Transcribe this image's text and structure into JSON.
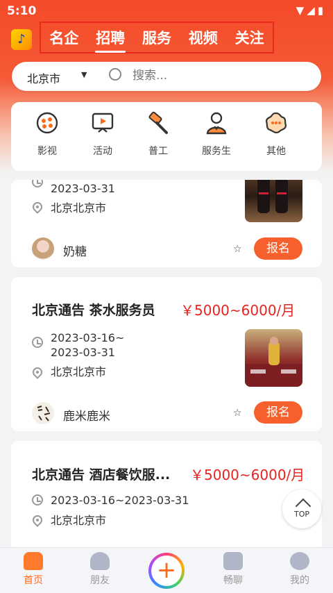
{
  "status": {
    "time": "5:10"
  },
  "top_tabs": [
    {
      "label": "名企"
    },
    {
      "label": "招聘"
    },
    {
      "label": "服务"
    },
    {
      "label": "视频"
    },
    {
      "label": "关注"
    }
  ],
  "search": {
    "city": "北京市",
    "placeholder": "搜索..."
  },
  "categories": [
    {
      "label": "影视",
      "icon": "film-reel-icon"
    },
    {
      "label": "活动",
      "icon": "screen-play-icon"
    },
    {
      "label": "普工",
      "icon": "hammer-icon"
    },
    {
      "label": "服务生",
      "icon": "waiter-icon"
    },
    {
      "label": "其他",
      "icon": "flower-more-icon"
    }
  ],
  "cards": [
    {
      "date": "2023-03-31",
      "location": "北京北京市",
      "user": "奶糖",
      "button": "报名"
    },
    {
      "title": "北京通告   茶水服务员",
      "price": "￥5000~6000/月",
      "date_line1": "2023-03-16~",
      "date_line2": "2023-03-31",
      "location": "北京北京市",
      "user": "鹿米鹿米",
      "button": "报名"
    },
    {
      "title": "北京通告   酒店餐饮服...",
      "price": "￥5000~6000/月",
      "date": "2023-03-16~2023-03-31",
      "location": "北京北京市"
    }
  ],
  "back_to_top": "TOP",
  "tabbar": [
    {
      "label": "首页",
      "icon": "home-icon",
      "active": true
    },
    {
      "label": "朋友",
      "icon": "friends-icon"
    },
    {
      "label": "",
      "icon": "plus-icon"
    },
    {
      "label": "畅聊",
      "icon": "chat-icon"
    },
    {
      "label": "我的",
      "icon": "profile-icon"
    }
  ],
  "colors": {
    "brand": "#f44a2a",
    "accent": "#f6602c",
    "price": "#e8231f"
  }
}
